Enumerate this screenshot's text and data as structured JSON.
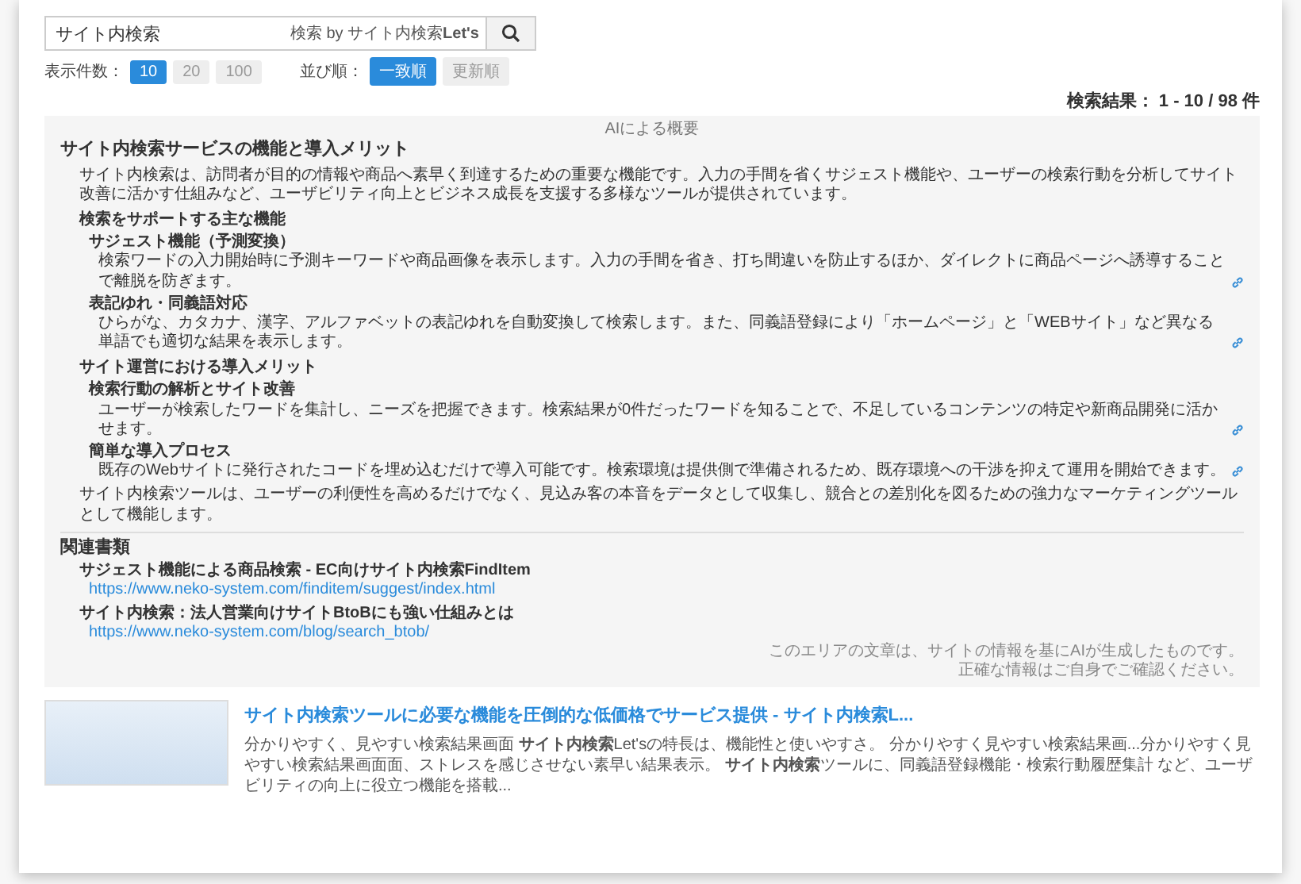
{
  "search": {
    "value": "サイト内検索",
    "powered_by": "検索 by サイト内検索**Let's**"
  },
  "display_count": {
    "label": "表示件数：",
    "options": [
      {
        "label": "10",
        "selected": true
      },
      {
        "label": "20",
        "selected": false
      },
      {
        "label": "100",
        "selected": false
      }
    ]
  },
  "sort": {
    "label": "並び順：",
    "options": [
      {
        "label": "一致順",
        "selected": true
      },
      {
        "label": "更新順",
        "selected": false
      }
    ]
  },
  "result_count": "検索結果： 1 - 10 / 98 件",
  "ai_summary": {
    "header": "AIによる概要",
    "title": "サイト内検索サービスの機能と導入メリット",
    "intro": "サイト内検索は、訪問者が目的の情報や商品へ素早く到達するための重要な機能です。入力の手間を省くサジェスト機能や、ユーザーの検索行動を分析してサイト改善に活かす仕組みなど、ユーザビリティ向上とビジネス成長を支援する多様なツールが提供されています。",
    "sections": [
      {
        "heading": "検索をサポートする主な機能",
        "items": [
          {
            "title": "サジェスト機能（予測変換）",
            "text": "検索ワードの入力開始時に予測キーワードや商品画像を表示します。入力の手間を省き、打ち間違いを防止するほか、ダイレクトに商品ページへ誘導することで離脱を防ぎます。"
          },
          {
            "title": "表記ゆれ・同義語対応",
            "text": "ひらがな、カタカナ、漢字、アルファベットの表記ゆれを自動変換して検索します。また、同義語登録により「ホームページ」と「WEBサイト」など異なる単語でも適切な結果を表示します。"
          }
        ]
      },
      {
        "heading": "サイト運営における導入メリット",
        "items": [
          {
            "title": "検索行動の解析とサイト改善",
            "text": "ユーザーが検索したワードを集計し、ニーズを把握できます。検索結果が0件だったワードを知ることで、不足しているコンテンツの特定や新商品開発に活かせます。"
          },
          {
            "title": "簡単な導入プロセス",
            "text": "既存のWebサイトに発行されたコードを埋め込むだけで導入可能です。検索環境は提供側で準備されるため、既存環境への干渉を抑えて運用を開始できます。"
          }
        ]
      }
    ],
    "conclusion": "サイト内検索ツールは、ユーザーの利便性を高めるだけでなく、見込み客の本音をデータとして収集し、競合との差別化を図るための強力なマーケティングツールとして機能します。",
    "related": {
      "heading": "関連書類",
      "docs": [
        {
          "title": "サジェスト機能による商品検索 - EC向けサイト内検索FindItem",
          "url": "https://www.neko-system.com/finditem/suggest/index.html"
        },
        {
          "title": "サイト内検索：法人営業向けサイトBtoBにも強い仕組みとは",
          "url": "https://www.neko-system.com/blog/search_btob/"
        }
      ]
    },
    "disclaimer": [
      "このエリアの文章は、サイトの情報を基にAIが生成したものです。",
      "正確な情報はご自身でご確認ください。"
    ]
  },
  "results": [
    {
      "title": "サイト内検索ツールに必要な機能を圧倒的な低価格でサービス提供 - サイト内検索L...",
      "snippet": "分かりやすく、見やすい検索結果画面 **サイト内検索**Let'sの特長は、機能性と使いやすさ。 分かりやすく見やすい検索結果画...分かりやすく見やすい検索結果画面面、ストレスを感じさせない素早い結果表示。 **サイト内検索**ツールに、同義語登録機能・検索行動履歴集計 など、ユーザビリティの向上に役立つ機能を搭載..."
    }
  ]
}
